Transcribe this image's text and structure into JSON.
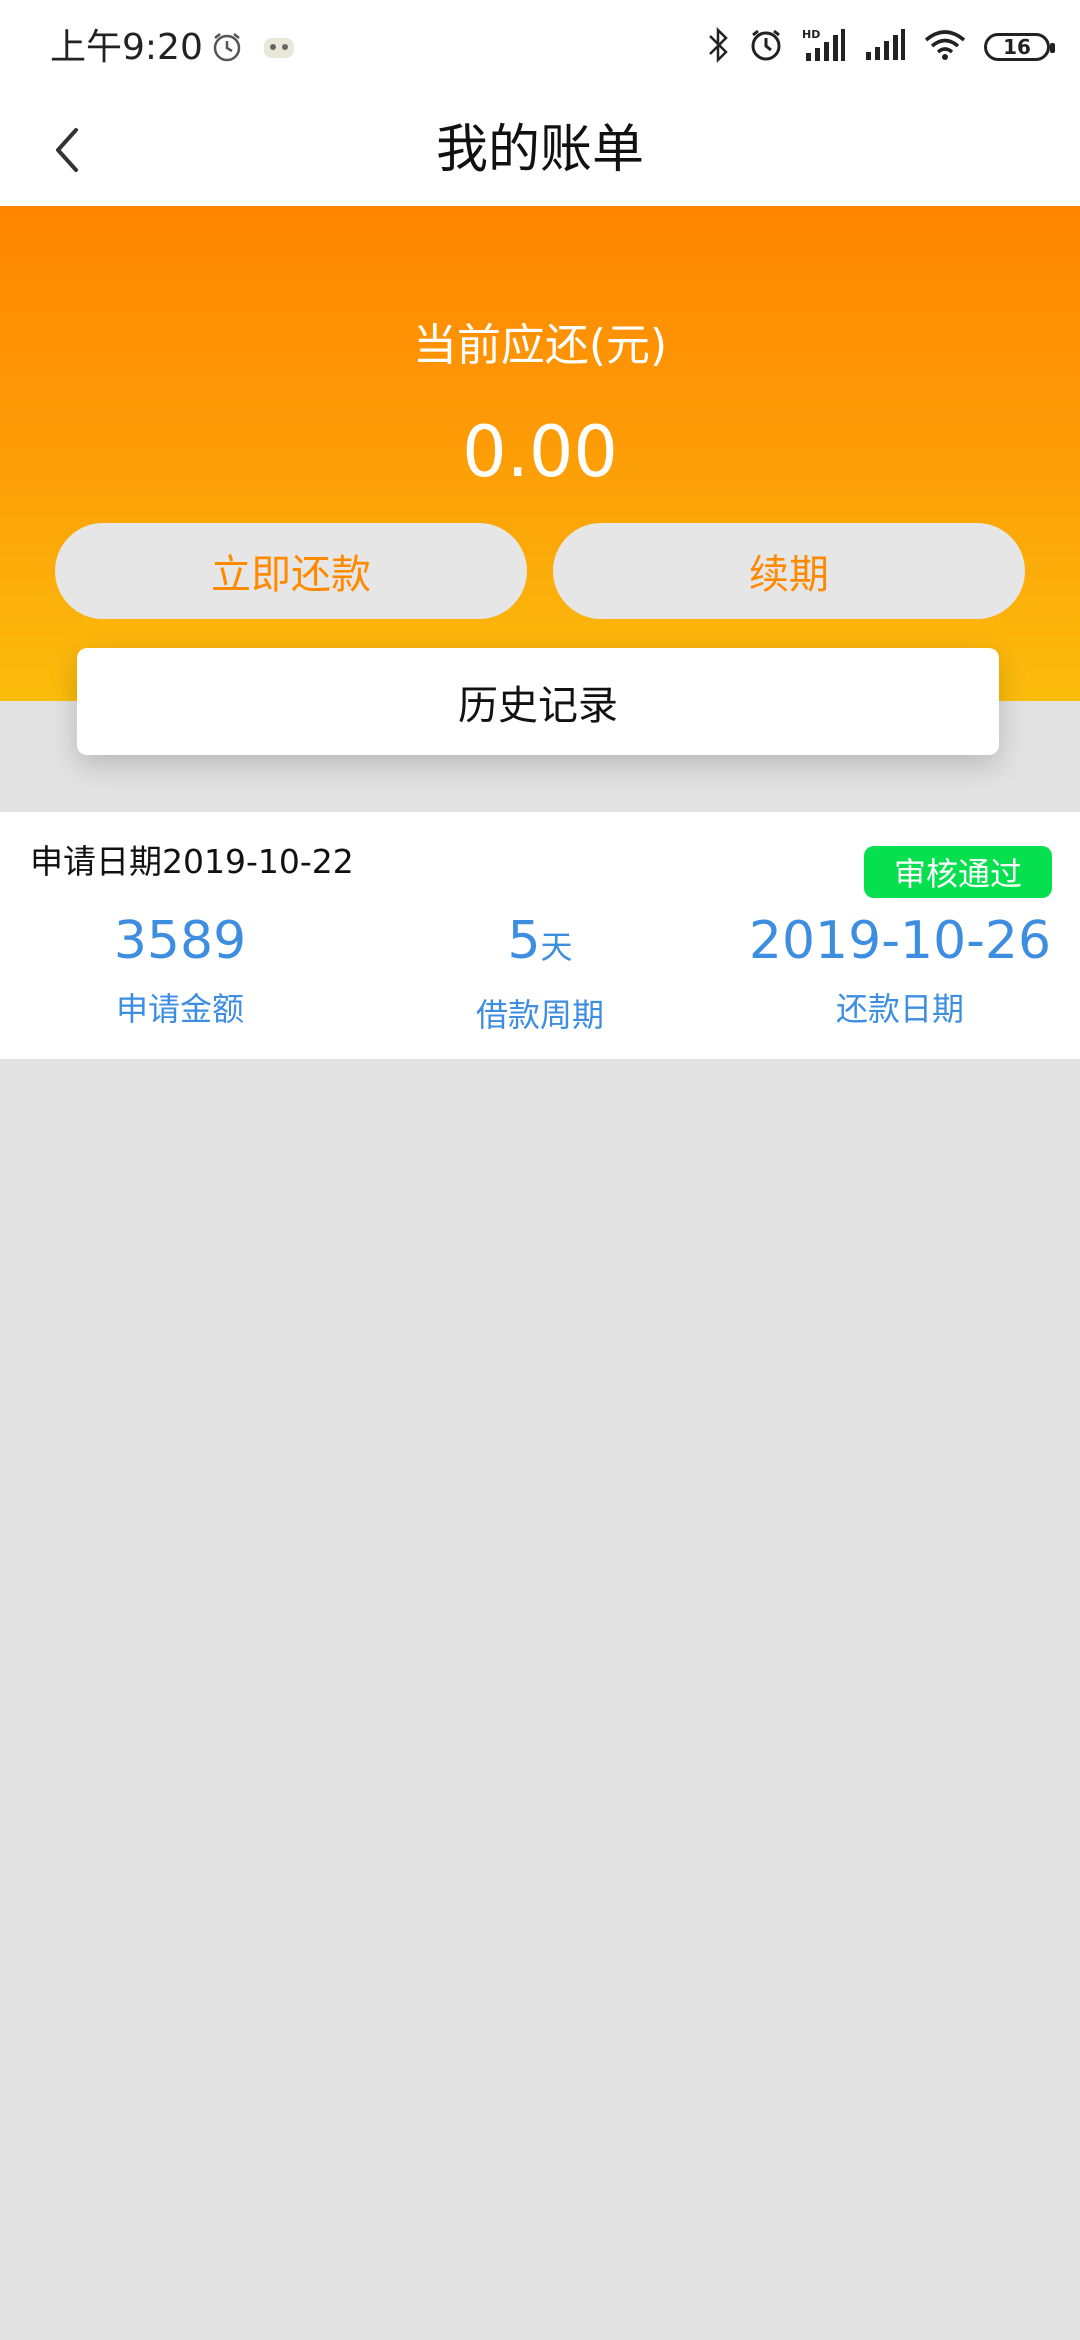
{
  "status_bar": {
    "time": "上午9:20",
    "battery": "16",
    "icons": [
      "alarm-icon",
      "app-notification-icon",
      "bluetooth-icon",
      "alarm-icon",
      "signal-hd-icon",
      "signal-icon",
      "wifi-icon",
      "battery-icon"
    ]
  },
  "nav": {
    "title": "我的账单"
  },
  "header": {
    "due_label": "当前应还(元)",
    "due_amount": "0.00",
    "repay_button": "立即还款",
    "renew_button": "续期",
    "history_button": "历史记录",
    "accent_color": "#ff8a00"
  },
  "bill": {
    "apply_date": "申请日期2019-10-22",
    "status": "审核通过",
    "status_color": "#06e04e",
    "amount": "3589",
    "amount_label": "申请金额",
    "period_value": "5",
    "period_unit": "天",
    "period_label": "借款周期",
    "repay_date": "2019-10-26",
    "repay_date_label": "还款日期",
    "value_color": "#3d8ee0"
  }
}
